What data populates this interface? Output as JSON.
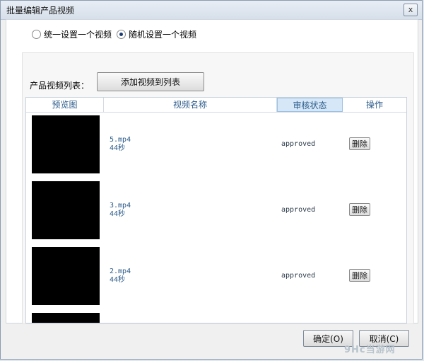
{
  "window": {
    "title": "批量编辑产品视频",
    "close_glyph": "x"
  },
  "options": {
    "radio_uniform": "统一设置一个视频",
    "radio_random": "随机设置一个视频",
    "selected": "random"
  },
  "list": {
    "label": "产品视频列表：",
    "add_button": "添加视频到列表",
    "columns": [
      "预览图",
      "视频名称",
      "审核状态",
      "操作"
    ],
    "rows": [
      {
        "file": "5.mp4",
        "duration": "44秒",
        "status": "approved",
        "action": "删除"
      },
      {
        "file": "3.mp4",
        "duration": "44秒",
        "status": "approved",
        "action": "删除"
      },
      {
        "file": "2.mp4",
        "duration": "44秒",
        "status": "approved",
        "action": "删除"
      }
    ]
  },
  "footer": {
    "ok": "确定(O)",
    "cancel": "取消(C)"
  },
  "watermark": "9Hc当游网"
}
